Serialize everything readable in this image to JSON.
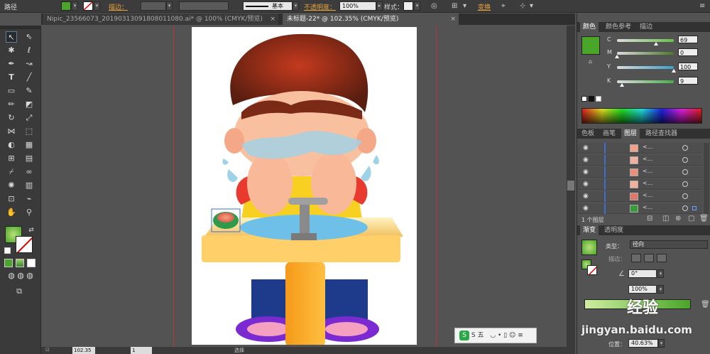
{
  "control_bar": {
    "object_label": "路径",
    "stroke_label": "描边：",
    "stroke_style": "基本",
    "opacity_label": "不透明度：",
    "opacity_value": "100%",
    "style_label": "样式：",
    "transform_label": "变换",
    "fill_color": "#4aa52a"
  },
  "doc_tabs": [
    {
      "label": "Nipic_23566073_20190313091808011080.ai* @ 100% (CMYK/预览)",
      "close": "×"
    },
    {
      "label": "未标题-22* @ 102.35% (CMYK/预览)",
      "close": "×"
    }
  ],
  "status_bar": {
    "zoom": "102.35",
    "page": "1",
    "tool": "选择"
  },
  "color_panel": {
    "tabs": [
      "颜色",
      "颜色参考",
      "描边"
    ],
    "swatch": "#4aa52a",
    "channels": [
      {
        "name": "C",
        "value": "69",
        "level": 0.69,
        "track": "#69c24a"
      },
      {
        "name": "M",
        "value": "0",
        "level": 0.0,
        "track": "#4a7a2a"
      },
      {
        "name": "Y",
        "value": "100",
        "level": 1.0,
        "track": "#3aa0c8"
      },
      {
        "name": "K",
        "value": "9",
        "level": 0.09,
        "track": "#48b048"
      }
    ]
  },
  "layers_panel": {
    "tabs": [
      "色板",
      "画笔",
      "图层",
      "路径查找器"
    ],
    "rows": [
      {
        "name": "<..."
      },
      {
        "name": "<..."
      },
      {
        "name": "<..."
      },
      {
        "name": "<..."
      },
      {
        "name": "<..."
      },
      {
        "name": "<..."
      }
    ],
    "count_label": "1 个图层"
  },
  "gradient_panel": {
    "tabs": [
      "渐变",
      "透明度"
    ],
    "type_label": "类型：",
    "type_value": "径向",
    "stroke_label": "描边：",
    "angle_value": "0°",
    "ratio_value": "100%",
    "position_label": "位置：",
    "position_value": "40.63%"
  },
  "watermark": {
    "brand": "经验",
    "url": "jingyan.baidu.com",
    "ime": "S 五"
  }
}
